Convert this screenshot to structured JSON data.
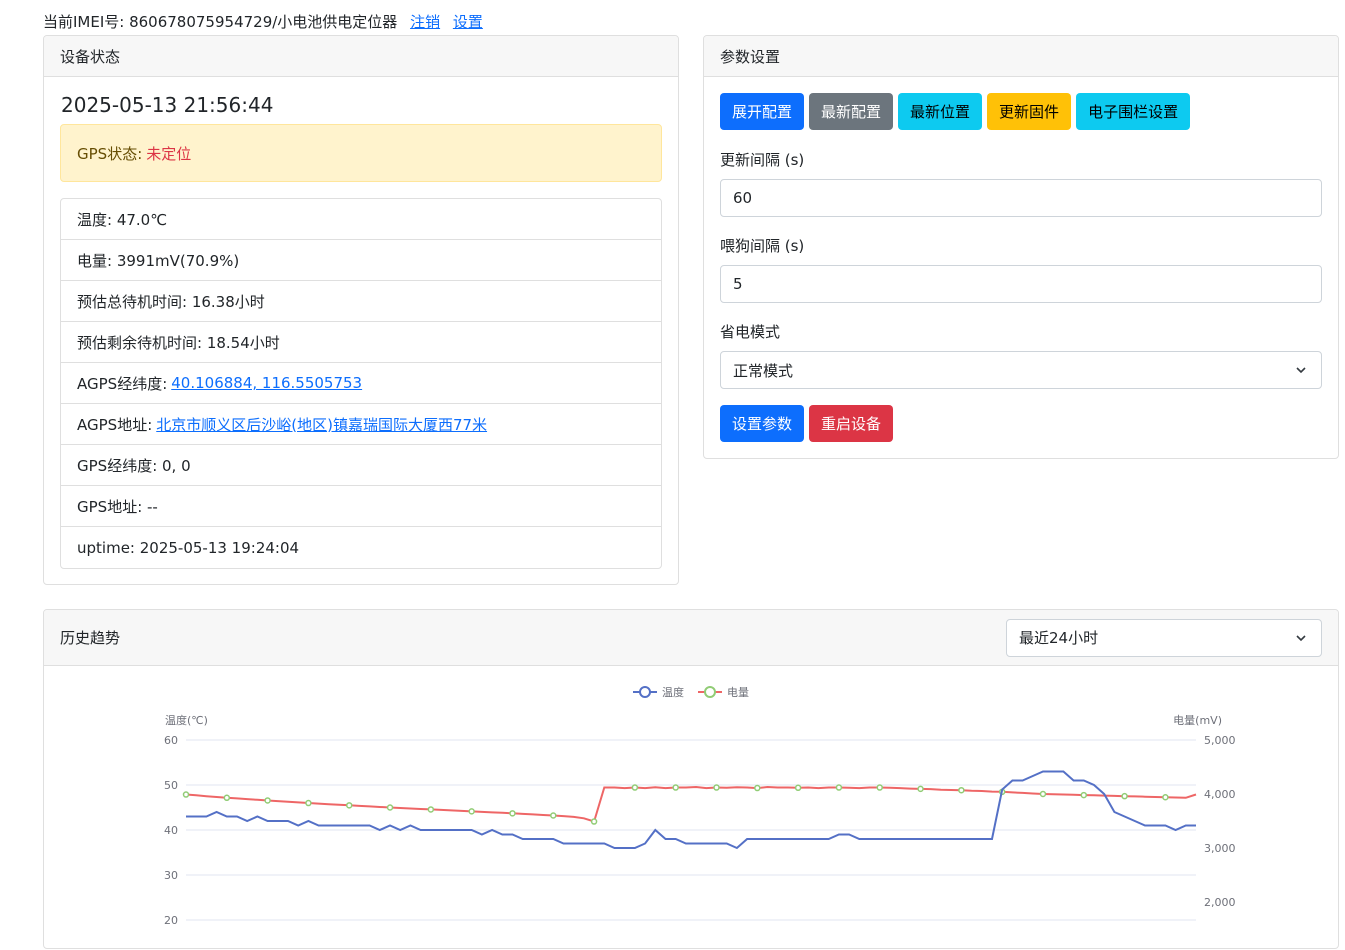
{
  "top": {
    "imei_label": "当前IMEI号: 860678075954729/小电池供电定位器",
    "logout_link": "注销",
    "settings_link": "设置"
  },
  "status": {
    "header": "设备状态",
    "datetime": "2025-05-13 21:56:44",
    "gps_status_label": "GPS状态:",
    "gps_status_value": "未定位",
    "items": [
      {
        "label": "温度: 47.0℃"
      },
      {
        "label": "电量: 3991mV(70.9%)"
      },
      {
        "label": "预估总待机时间: 16.38小时"
      },
      {
        "label": "预估剩余待机时间: 18.54小时"
      },
      {
        "label": "AGPS经纬度:",
        "link": "40.106884, 116.5505753"
      },
      {
        "label": "AGPS地址:",
        "link": "北京市顺义区后沙峪(地区)镇嘉瑞国际大厦西77米"
      },
      {
        "label": "GPS经纬度: 0, 0"
      },
      {
        "label": "GPS地址: --"
      },
      {
        "label": "uptime: 2025-05-13 19:24:04"
      }
    ]
  },
  "params": {
    "header": "参数设置",
    "buttons": {
      "expand": "展开配置",
      "latest_config": "最新配置",
      "latest_position": "最新位置",
      "update_firmware": "更新固件",
      "geofence": "电子围栏设置"
    },
    "update_interval": {
      "label": "更新间隔 (s)",
      "value": "60"
    },
    "watchdog_interval": {
      "label": "喂狗间隔 (s)",
      "value": "5"
    },
    "power_mode": {
      "label": "省电模式",
      "value": "正常模式"
    },
    "set_params": "设置参数",
    "reboot": "重启设备"
  },
  "history": {
    "header": "历史趋势",
    "range_select": "最近24小时"
  },
  "colors": {
    "temperature": "#5470c6",
    "battery": "#ee6666",
    "marker_fill": "#91cc75"
  },
  "chart_data": {
    "type": "line",
    "legend": [
      "温度",
      "电量"
    ],
    "legend_position": "top-center",
    "grid": true,
    "y_left": {
      "label": "温度(℃)",
      "ticks": [
        "60",
        "50",
        "40",
        "30",
        "20"
      ],
      "range": [
        0,
        60
      ]
    },
    "y_right": {
      "label": "电量(mV)",
      "ticks": [
        "5,000",
        "4,000",
        "3,000",
        "2,000"
      ],
      "range": [
        0,
        5000
      ]
    },
    "series": [
      {
        "name": "温度",
        "values": [
          43,
          43,
          43,
          44,
          43,
          43,
          42,
          43,
          42,
          42,
          42,
          41,
          42,
          41,
          41,
          41,
          41,
          41,
          41,
          40,
          41,
          40,
          41,
          40,
          40,
          40,
          40,
          40,
          40,
          39,
          40,
          39,
          39,
          38,
          38,
          38,
          38,
          37,
          37,
          37,
          37,
          37,
          36,
          36,
          36,
          37,
          40,
          38,
          38,
          37,
          37,
          37,
          37,
          37,
          36,
          38,
          38,
          38,
          38,
          38,
          38,
          38,
          38,
          38,
          39,
          39,
          38,
          38,
          38,
          38,
          38,
          38,
          38,
          38,
          38,
          38,
          38,
          38,
          38,
          38,
          49,
          51,
          51,
          52,
          53,
          53,
          53,
          51,
          51,
          50,
          48,
          44,
          43,
          42,
          41,
          41,
          41,
          40,
          41,
          41
        ]
      },
      {
        "name": "电量",
        "values": [
          3990,
          3975,
          3960,
          3945,
          3930,
          3918,
          3905,
          3892,
          3880,
          3868,
          3856,
          3844,
          3833,
          3822,
          3811,
          3800,
          3790,
          3780,
          3770,
          3760,
          3750,
          3741,
          3732,
          3723,
          3714,
          3705,
          3696,
          3687,
          3678,
          3669,
          3660,
          3651,
          3642,
          3632,
          3622,
          3612,
          3602,
          3590,
          3575,
          3550,
          3490,
          4120,
          4120,
          4110,
          4120,
          4110,
          4125,
          4110,
          4120,
          4120,
          4130,
          4110,
          4120,
          4115,
          4125,
          4120,
          4110,
          4130,
          4120,
          4120,
          4115,
          4120,
          4110,
          4120,
          4120,
          4115,
          4110,
          4120,
          4120,
          4115,
          4110,
          4100,
          4095,
          4090,
          4080,
          4075,
          4070,
          4060,
          4055,
          4045,
          4040,
          4030,
          4020,
          4010,
          4000,
          3995,
          3990,
          3985,
          3980,
          3975,
          3970,
          3965,
          3960,
          3955,
          3950,
          3945,
          3940,
          3935,
          3930,
          3990
        ]
      }
    ]
  }
}
